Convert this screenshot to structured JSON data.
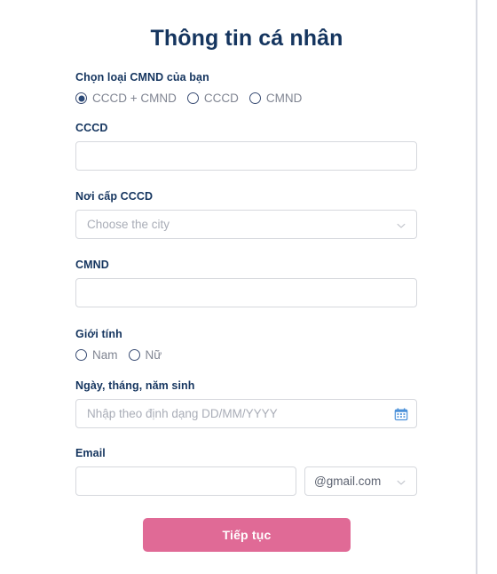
{
  "page": {
    "title": "Thông tin cá nhân",
    "accent_pink": "#e06a96",
    "navy": "#15355f",
    "label_gray": "#808592",
    "border_gray": "#d6d8dd",
    "calendar_icon_blue": "#4a90d9"
  },
  "id_type": {
    "label": "Chọn loại CMND của bạn",
    "options": [
      {
        "label": "CCCD + CMND",
        "selected": true
      },
      {
        "label": "CCCD",
        "selected": false
      },
      {
        "label": "CMND",
        "selected": false
      }
    ]
  },
  "cccd": {
    "label": "CCCD",
    "value": "",
    "placeholder": ""
  },
  "cccd_place": {
    "label": "Nơi cấp CCCD",
    "selected": "Choose the city",
    "icon": "chevron-down-icon"
  },
  "cmnd": {
    "label": "CMND",
    "value": "",
    "placeholder": ""
  },
  "gender": {
    "label": "Giới tính",
    "options": [
      {
        "label": "Nam",
        "selected": false
      },
      {
        "label": "Nữ",
        "selected": false
      }
    ]
  },
  "dob": {
    "label": "Ngày, tháng, năm sinh",
    "value": "",
    "placeholder": "Nhập theo định dạng DD/MM/YYYY",
    "icon": "calendar-icon"
  },
  "email": {
    "label": "Email",
    "value": "",
    "placeholder": "",
    "domain_selected": "@gmail.com",
    "domain_icon": "chevron-down-icon"
  },
  "submit": {
    "label": "Tiếp tục"
  }
}
